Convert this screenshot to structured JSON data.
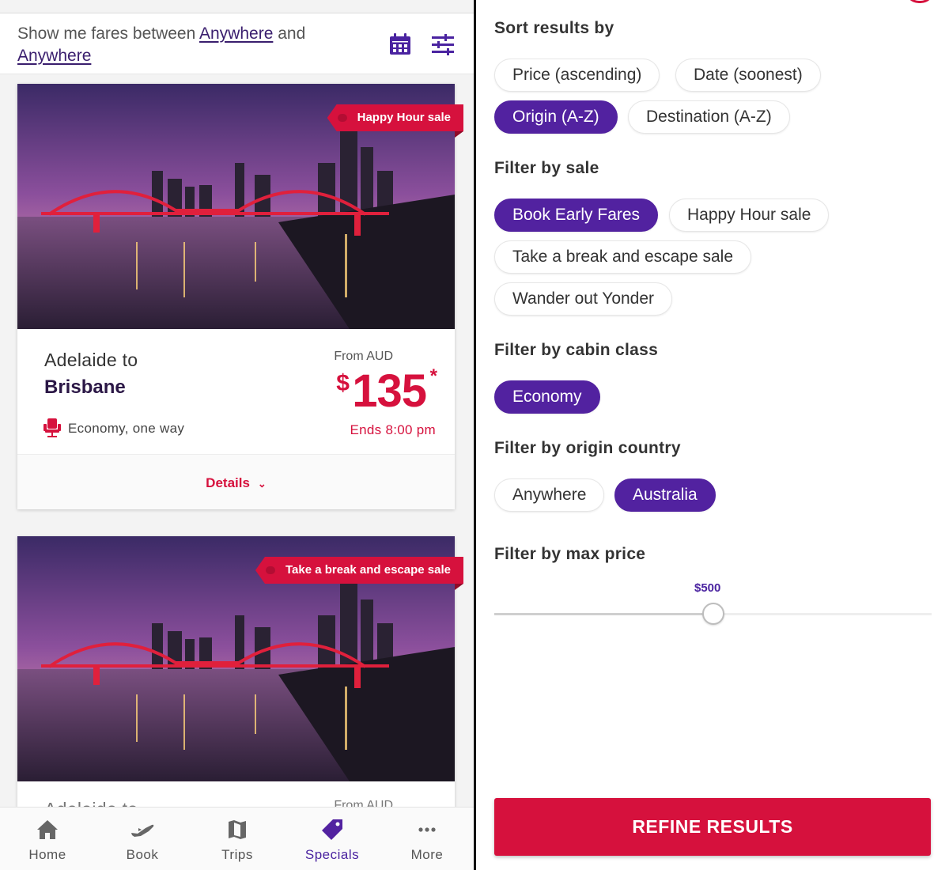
{
  "header": {
    "fare_prefix": "Show me fares between",
    "from_link": "Anywhere",
    "fare_and": "and",
    "to_link": "Anywhere",
    "icons": [
      "calendar-icon",
      "filter-sliders-icon"
    ]
  },
  "cards": [
    {
      "badge": "Happy Hour sale",
      "route_from": "Adelaide to",
      "route_to": "Brisbane",
      "from_label": "From AUD",
      "currency_symbol": "$",
      "price": "135",
      "asterisk": "*",
      "cabin": "Economy, one way",
      "ends": "Ends 8:00 pm",
      "details_label": "Details"
    },
    {
      "badge": "Take a break and escape sale",
      "route_from": "Adelaide to",
      "from_label": "From AUD"
    }
  ],
  "tabbar": [
    {
      "label": "Home",
      "icon": "home-icon"
    },
    {
      "label": "Book",
      "icon": "plane-icon"
    },
    {
      "label": "Trips",
      "icon": "map-icon"
    },
    {
      "label": "Specials",
      "icon": "tag-icon",
      "active": true
    },
    {
      "label": "More",
      "icon": "more-dots-icon"
    }
  ],
  "sort": {
    "title": "Sort results by",
    "options": [
      {
        "label": "Price (ascending)",
        "selected": false
      },
      {
        "label": "Date (soonest)",
        "selected": false
      },
      {
        "label": "Origin (A-Z)",
        "selected": true
      },
      {
        "label": "Destination (A-Z)",
        "selected": false
      }
    ]
  },
  "sale_filter": {
    "title": "Filter by sale",
    "options": [
      {
        "label": "Book Early Fares",
        "selected": true
      },
      {
        "label": "Happy Hour sale",
        "selected": false
      },
      {
        "label": "Take a break and escape sale",
        "selected": false
      },
      {
        "label": "Wander out Yonder",
        "selected": false
      }
    ]
  },
  "cabin_filter": {
    "title": "Filter by cabin class",
    "options": [
      {
        "label": "Economy",
        "selected": true
      }
    ]
  },
  "origin_filter": {
    "title": "Filter by origin country",
    "options": [
      {
        "label": "Anywhere",
        "selected": false
      },
      {
        "label": "Australia",
        "selected": true
      }
    ]
  },
  "price_filter": {
    "title": "Filter by max price",
    "value_label": "$500",
    "fraction": 0.5
  },
  "refine_label": "REFINE RESULTS",
  "colors": {
    "brand_red": "#d6113d",
    "brand_purple": "#5222a0",
    "dark_purple": "#3a1e6e"
  }
}
